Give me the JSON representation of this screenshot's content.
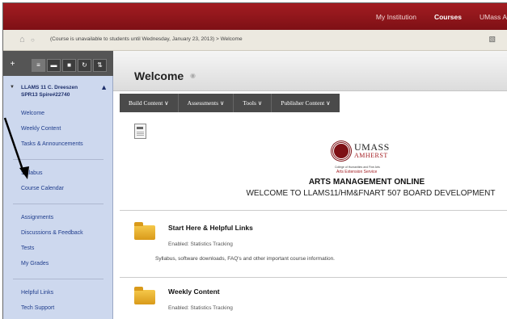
{
  "topnav": {
    "items": [
      "My Institution",
      "Courses",
      "UMass A"
    ],
    "active_index": 1
  },
  "breadcrumb": {
    "text": "(Course is unavailable to students until Wednesday, January 23, 2013) > Welcome"
  },
  "left_panel": {
    "toolbar_icons": [
      "plus-icon",
      "list-icon",
      "folder-icon",
      "calendar-icon",
      "refresh-icon",
      "sort-icon"
    ],
    "toolbar_glyphs": [
      "+",
      "≡",
      "▬",
      "■",
      "↻",
      "⇅"
    ],
    "course_name": "LLAMS 11 C. Dreeszen SPR13 Spire#22740",
    "groups": [
      [
        "Welcome",
        "Weekly Content",
        "Tasks & Announcements"
      ],
      [
        "Syllabus",
        "Course Calendar"
      ],
      [
        "Assignments",
        "Discussions & Feedback",
        "Tests",
        "My Grades"
      ],
      [
        "Helpful Links",
        "Tech Support"
      ]
    ]
  },
  "page": {
    "title": "Welcome",
    "actions": [
      "Build Content ∨",
      "Assessments ∨",
      "Tools ∨",
      "Publisher Content ∨"
    ],
    "logo": {
      "line1": "UMASS",
      "line2": "AMHERST",
      "sub1": "College of Humanities and Fine Arts",
      "sub2": "Arts Extension Service"
    },
    "headline": "ARTS MANAGEMENT ONLINE",
    "subheadline": "WELCOME TO LLAMS11/HM&FNART 507 BOARD DEVELOPMENT",
    "items": [
      {
        "title": "Start Here & Helpful Links",
        "meta": "Enabled:  Statistics Tracking",
        "desc": "Syllabus, software downloads, FAQ's and other important course information."
      },
      {
        "title": "Weekly Content",
        "meta": "Enabled:  Statistics Tracking",
        "desc": ""
      }
    ]
  },
  "colors": {
    "header_red": "#a31d22",
    "panel_blue": "#cdd8ee",
    "link_blue": "#1f3d8c",
    "folder_yellow": "#f5c84a"
  }
}
